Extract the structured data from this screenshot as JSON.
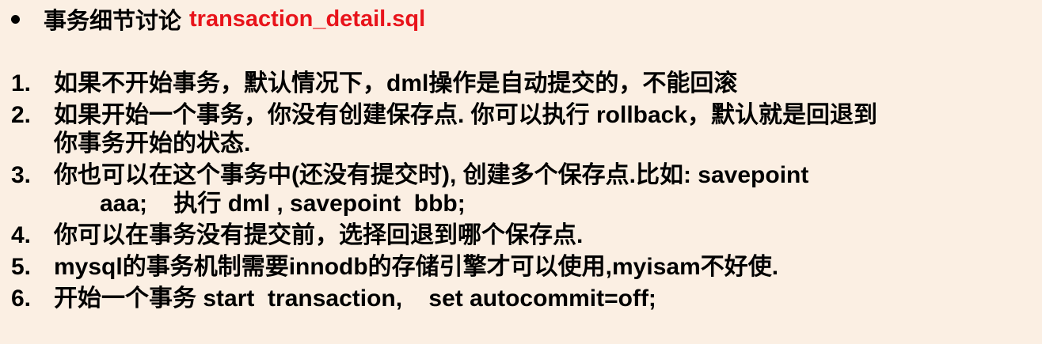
{
  "title": {
    "text": "事务细节讨论",
    "filename": "transaction_detail.sql"
  },
  "items": [
    {
      "number": "1.",
      "lines": [
        "如果不开始事务，默认情况下，dml操作是自动提交的，不能回滚"
      ]
    },
    {
      "number": "2.",
      "lines": [
        "如果开始一个事务，你没有创建保存点. 你可以执行 rollback，默认就是回退到",
        "你事务开始的状态."
      ]
    },
    {
      "number": "3.",
      "lines": [
        "你也可以在这个事务中(还没有提交时), 创建多个保存点.比如: savepoint",
        "aaa;    执行 dml , savepoint  bbb;"
      ]
    },
    {
      "number": "4.",
      "lines": [
        "你可以在事务没有提交前，选择回退到哪个保存点."
      ]
    },
    {
      "number": "5.",
      "lines": [
        "mysql的事务机制需要innodb的存储引擎才可以使用,myisam不好使."
      ]
    },
    {
      "number": "6.",
      "lines": [
        "开始一个事务 start  transaction,    set autocommit=off;"
      ]
    }
  ],
  "colors": {
    "background": "#fbefe3",
    "text": "#000000",
    "filename": "#e8141b"
  }
}
